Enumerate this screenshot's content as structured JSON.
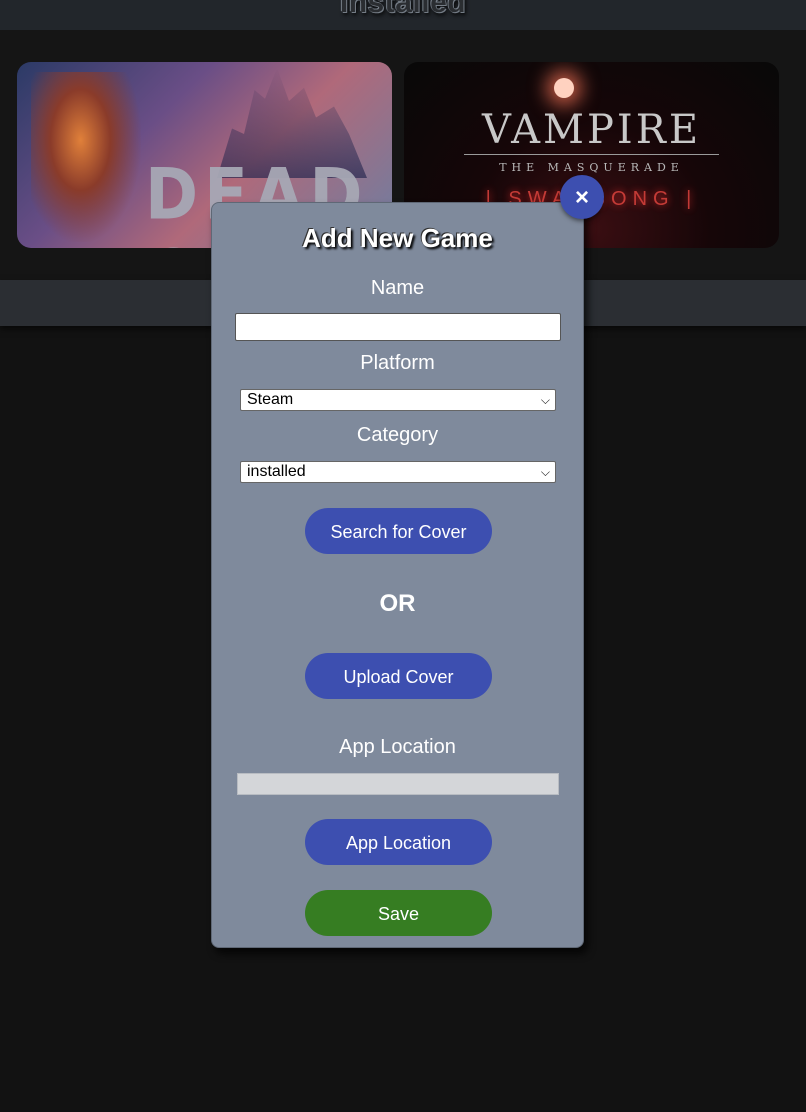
{
  "background_section": {
    "title": "Installed",
    "games": [
      {
        "name": "Dead Cells",
        "logo_text": "DEAD CELLS"
      },
      {
        "name": "Vampire: The Masquerade - Swansong",
        "logo_text": "VAMPIRE",
        "subtitle_text": "THE MASQUERADE",
        "neon_text": "| SWANSONG |"
      }
    ]
  },
  "modal": {
    "title": "Add New Game",
    "close_icon": "×",
    "name_label": "Name",
    "name_value": "",
    "platform_label": "Platform",
    "platform_selected": "Steam",
    "category_label": "Category",
    "category_selected": "installed",
    "search_cover_label": "Search for Cover",
    "or_text": "OR",
    "upload_cover_label": "Upload Cover",
    "app_location_label": "App Location",
    "app_location_value": "",
    "app_location_button": "App Location",
    "save_label": "Save"
  },
  "icons": {
    "close": "close-icon",
    "dropdown": "chevron-down-icon"
  },
  "colors": {
    "modal_bg": "#7f8a9c",
    "primary_button": "#3d4fb0",
    "save_button": "#367d22",
    "page_bg": "#121212"
  }
}
